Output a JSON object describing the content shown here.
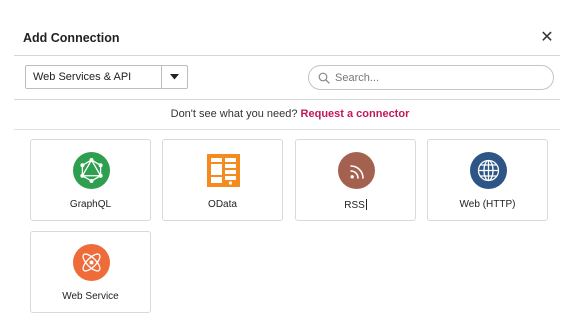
{
  "dialog": {
    "title": "Add Connection",
    "close_icon": "close-icon"
  },
  "filter": {
    "category_selected": "Web Services & API",
    "dropdown_icon": "chevron-down-icon"
  },
  "search": {
    "placeholder": "Search...",
    "value": "",
    "icon": "search-icon"
  },
  "notice": {
    "text": "Don't see what you need?",
    "link": "Request a connector"
  },
  "connectors": [
    {
      "label": "GraphQL",
      "icon": "graphql-icon",
      "color": "#2e9e4f"
    },
    {
      "label": "OData",
      "icon": "odata-icon",
      "color": "#f58b1f"
    },
    {
      "label": "RSS",
      "icon": "rss-icon",
      "color": "#a5614f"
    },
    {
      "label": "Web (HTTP)",
      "icon": "globe-icon",
      "color": "#2d5585"
    },
    {
      "label": "Web Service",
      "icon": "atom-icon",
      "color": "#ef6c3a"
    }
  ],
  "colors": {
    "accent_link": "#c2185b"
  }
}
